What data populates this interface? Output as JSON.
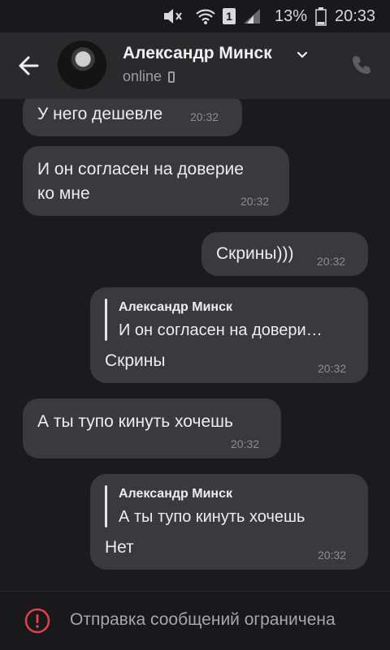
{
  "status_bar": {
    "battery": "13%",
    "time": "20:33",
    "sim_badge": "1"
  },
  "header": {
    "contact_name": "Александр Минск",
    "presence": "online"
  },
  "messages": [
    {
      "direction": "incoming",
      "text": "У него дешевле",
      "time": "20:32"
    },
    {
      "direction": "incoming",
      "text_line1": "И он согласен на доверие",
      "text_line2": "ко мне",
      "time": "20:32"
    },
    {
      "direction": "outgoing",
      "text": "Скрины)))",
      "time": "20:32"
    },
    {
      "direction": "outgoing",
      "quote_author": "Александр Минск",
      "quote_text": "И он согласен на довери…",
      "text": "Скрины",
      "time": "20:32"
    },
    {
      "direction": "incoming",
      "text": "А ты тупо кинуть хочешь",
      "time": "20:32"
    },
    {
      "direction": "outgoing",
      "quote_author": "Александр Минск",
      "quote_text": "А ты тупо кинуть хочешь",
      "text": "Нет",
      "time": "20:32"
    }
  ],
  "footer": {
    "notice": "Отправка сообщений ограничена",
    "icon": "warning-circle-icon"
  },
  "colors": {
    "background": "#1b1b1d",
    "bubble": "#3a3a3c",
    "header": "#2a2a2c",
    "warning": "#e0424b"
  }
}
